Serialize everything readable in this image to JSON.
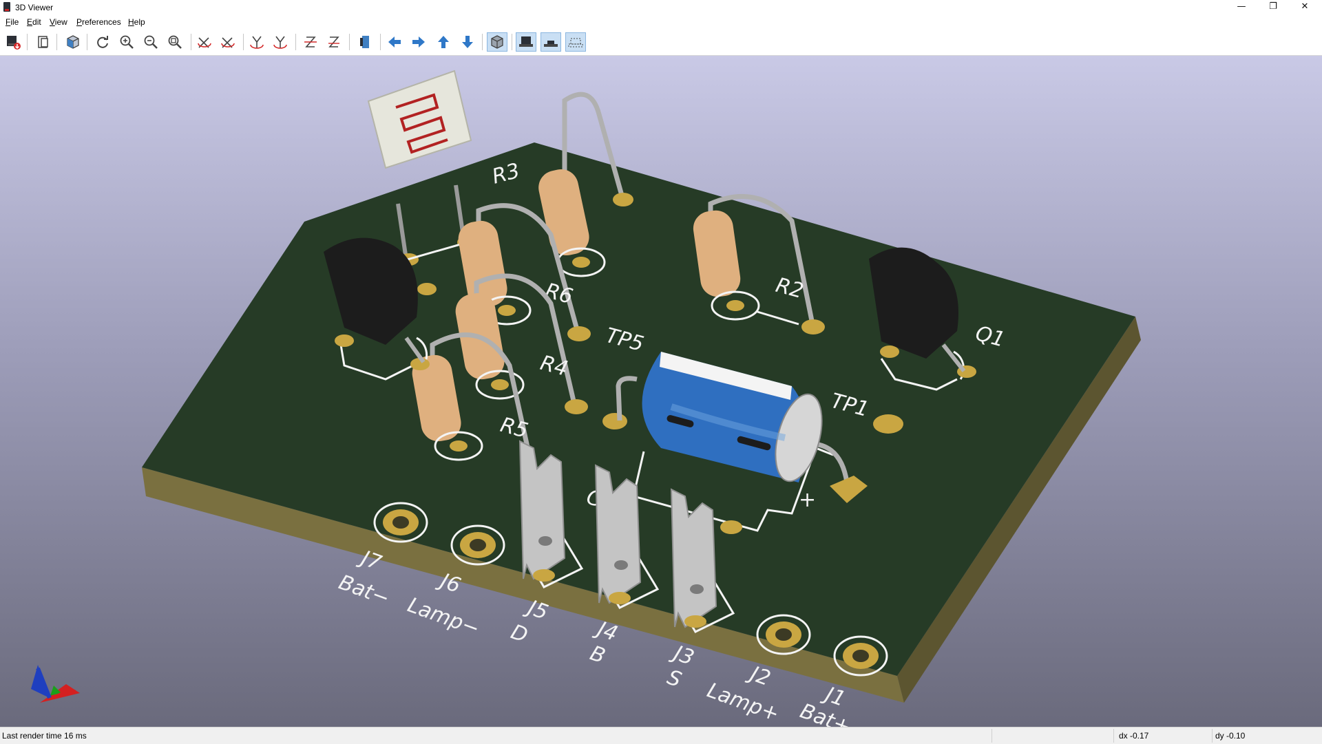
{
  "window": {
    "title": "3D Viewer",
    "minimize": "—",
    "maximize": "❐",
    "close": "✕"
  },
  "menu": {
    "file": {
      "u": "F",
      "rest": "ile"
    },
    "edit": {
      "u": "E",
      "rest": "dit"
    },
    "view": {
      "u": "V",
      "rest": "iew"
    },
    "preferences": {
      "u": "P",
      "rest": "references"
    },
    "help": {
      "u": "H",
      "rest": "elp"
    }
  },
  "toolbar": {
    "buttons": [
      {
        "name": "export-image",
        "icon": "export-icon"
      },
      {
        "name": "copy-to-clipboard",
        "icon": "clipboard-icon"
      },
      {
        "name": "raytracing",
        "icon": "render-icon"
      },
      {
        "name": "reload",
        "icon": "refresh-icon"
      },
      {
        "name": "zoom-in",
        "icon": "zoom-in-icon"
      },
      {
        "name": "zoom-out",
        "icon": "zoom-out-icon"
      },
      {
        "name": "zoom-fit",
        "icon": "zoom-fit-icon"
      },
      {
        "name": "rotate-x-cw",
        "icon": "rotate-x-icon"
      },
      {
        "name": "rotate-x-ccw",
        "icon": "rotate-x-icon"
      },
      {
        "name": "rotate-y-cw",
        "icon": "rotate-y-icon"
      },
      {
        "name": "rotate-y-ccw",
        "icon": "rotate-y-icon"
      },
      {
        "name": "rotate-z-cw",
        "icon": "rotate-z-icon"
      },
      {
        "name": "rotate-z-ccw",
        "icon": "rotate-z-icon"
      },
      {
        "name": "flip-board",
        "icon": "flip-board-icon"
      },
      {
        "name": "pan-left",
        "icon": "arrow-left-icon"
      },
      {
        "name": "pan-right",
        "icon": "arrow-right-icon"
      },
      {
        "name": "pan-up",
        "icon": "arrow-up-icon"
      },
      {
        "name": "pan-down",
        "icon": "arrow-down-icon"
      },
      {
        "name": "orthographic",
        "icon": "ortho-icon",
        "active": true
      },
      {
        "name": "show-tht-models",
        "icon": "tht-icon",
        "active": true
      },
      {
        "name": "show-smd-models",
        "icon": "smd-icon",
        "active": true
      },
      {
        "name": "show-virtual-models",
        "icon": "virtual-icon",
        "active": true
      }
    ]
  },
  "board": {
    "labels": {
      "r3": "R3",
      "r6": "R6",
      "r4": "R4",
      "r5": "R5",
      "r2": "R2",
      "q1": "Q1",
      "tp5": "TP5",
      "tp1": "TP1",
      "c1": "C1",
      "j7": "J7",
      "j6": "J6",
      "j5": "J5",
      "j4": "J4",
      "j3": "J3",
      "j2": "J2",
      "j1": "J1",
      "bat_minus": "Bat−",
      "lamp_minus": "Lamp−",
      "d": "D",
      "b": "B",
      "s": "S",
      "lamp_plus": "Lamp+",
      "bat_plus": "Bat+",
      "plus": "+"
    },
    "colors": {
      "pcb": "#263b26",
      "pcb_edge": "#7a7040",
      "pad": "#c9a642",
      "silkscreen": "#f4f4f4",
      "background_top": "#c9c9e6",
      "background_bottom": "#6a6a7c"
    }
  },
  "status": {
    "render_time": "Last render time 16 ms",
    "dx": "dx -0.17",
    "dy": "dy -0.10"
  }
}
